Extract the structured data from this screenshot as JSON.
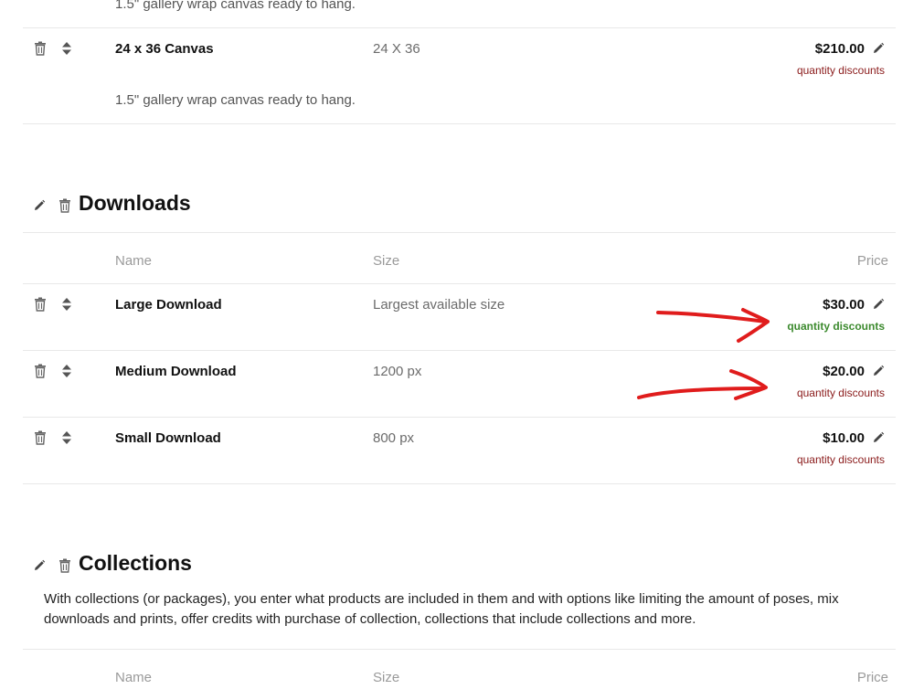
{
  "canvas_section": {
    "top_desc": "1.5\" gallery wrap canvas ready to hang.",
    "row": {
      "name": "24 x 36 Canvas",
      "size": "24 X 36",
      "price": "$210.00",
      "discount_label": "quantity discounts",
      "description": "1.5\" gallery wrap canvas ready to hang."
    }
  },
  "downloads": {
    "title": "Downloads",
    "columns": {
      "name": "Name",
      "size": "Size",
      "price": "Price"
    },
    "rows": [
      {
        "name": "Large Download",
        "size": "Largest available size",
        "price": "$30.00",
        "discount_label": "quantity discounts",
        "discount_active": true
      },
      {
        "name": "Medium Download",
        "size": "1200 px",
        "price": "$20.00",
        "discount_label": "quantity discounts",
        "discount_active": false
      },
      {
        "name": "Small Download",
        "size": "800 px",
        "price": "$10.00",
        "discount_label": "quantity discounts",
        "discount_active": false
      }
    ]
  },
  "collections": {
    "title": "Collections",
    "description": "With collections (or packages), you enter what products are included in them and with options like limiting the amount of poses, mix downloads and prints, offer credits with purchase of collection, collections that include collections and more.",
    "columns": {
      "name": "Name",
      "size": "Size",
      "price": "Price"
    }
  },
  "colors": {
    "discount_default": "#8a1a1a",
    "discount_active": "#3c8a2e",
    "annotation_arrow": "#e01c1c"
  },
  "icons": [
    "trash-icon",
    "sort-arrows-icon",
    "pencil-icon"
  ]
}
